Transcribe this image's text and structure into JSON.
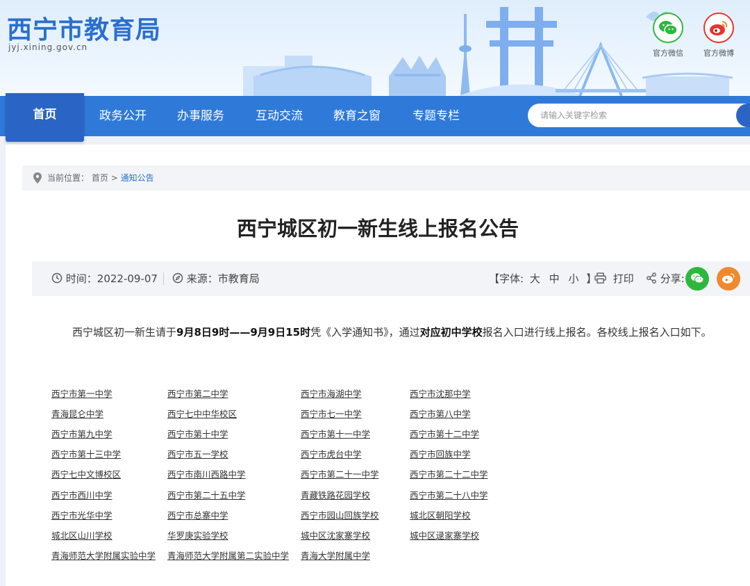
{
  "header": {
    "site_title": "西宁市教育局",
    "site_url": "jyj.xining.gov.cn",
    "wechat_label": "官方微信",
    "weibo_label": "官方微博"
  },
  "nav": {
    "items": [
      "首页",
      "政务公开",
      "办事服务",
      "互动交流",
      "教育之窗",
      "专题专栏"
    ],
    "active_index": 0,
    "search_placeholder": "请输入关键字检索"
  },
  "breadcrumb": {
    "prefix": "当前位置：",
    "home": "首页",
    "separator": ">",
    "current": "通知公告"
  },
  "article": {
    "title": "西宁城区初一新生线上报名公告",
    "time_label": "时间：",
    "time_value": "2022-09-07",
    "source_label": "来源：",
    "source_value": "市教育局",
    "font_label": "【字体:",
    "font_large": "大",
    "font_medium": "中",
    "font_small": "小",
    "font_close": "】",
    "print_label": "打印",
    "share_label": "分享:",
    "paragraph": {
      "p1": "西宁城区初一新生请于",
      "b1": "9月8日9时——9月9日15时",
      "p2": "凭《入学通知书》，通过",
      "b2": "对应初中学校",
      "p3": "报名入口进行线上报名。各校线上报名入口如下。"
    }
  },
  "schools": [
    [
      "西宁市第一中学",
      "西宁市第二中学",
      "西宁市海湖中学",
      "西宁市沈那中学"
    ],
    [
      "青海昆仑中学",
      "西宁七中中华校区",
      "西宁市七一中学",
      "西宁市第八中学"
    ],
    [
      "西宁市第九中学",
      "西宁市第十中学",
      "西宁市第十一中学",
      "西宁市第十二中学"
    ],
    [
      "西宁市第十三中学",
      "西宁市五一学校",
      "西宁市虎台中学",
      "西宁市回族中学"
    ],
    [
      "西宁七中文博校区",
      "西宁市南川西路中学",
      "西宁市第二十一中学",
      "西宁市第二十二中学"
    ],
    [
      "西宁市西川中学",
      "西宁市第二十五中学",
      "青藏铁路花园学校",
      "西宁市第二十八中学"
    ],
    [
      "西宁市光华中学",
      "西宁市总寨中学",
      "西宁市园山回族学校",
      "城北区朝阳学校"
    ],
    [
      "城北区山川学校",
      "华罗庚实验学校",
      "城中区沈家寨学校",
      "城中区逯家寨学校"
    ],
    [
      "青海师范大学附属实验中学",
      "青海师范大学附属第二实验中学",
      "青海大学附属中学"
    ]
  ],
  "colors": {
    "brand_blue": "#2f7ad9",
    "nav_active": "#2a64c4",
    "wechat_green": "#2db83d",
    "weibo_red": "#e6352c",
    "share_orange": "#f0892e"
  }
}
